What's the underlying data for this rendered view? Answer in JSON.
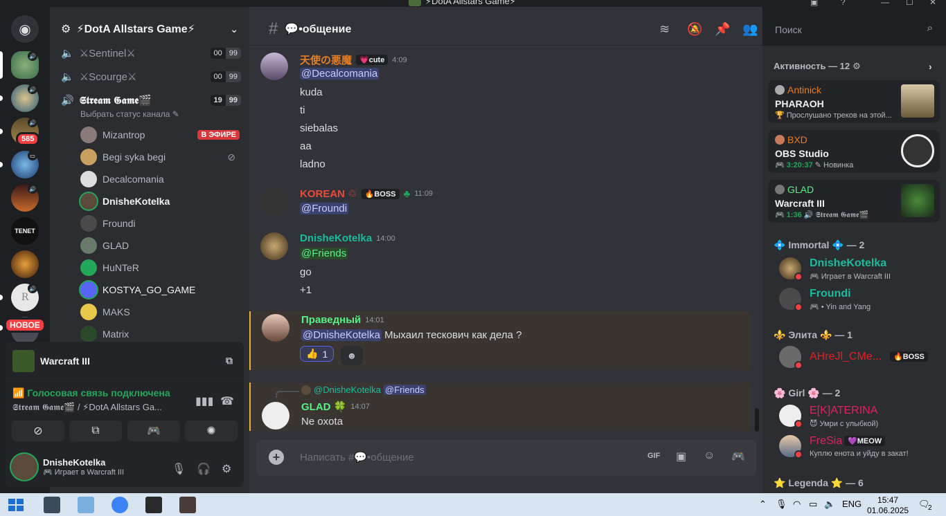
{
  "window": {
    "title": "⚡DotA Allstars Game⚡"
  },
  "servers": {
    "mention_badge": "585",
    "new_badge": "НОВОЕ",
    "tenet_label": "TENET",
    "r_label": "R"
  },
  "sidebar": {
    "server_name": "⚡DotA Allstars Game⚡",
    "channels": [
      {
        "name": "⚔Sentinel⚔",
        "left": "00",
        "right": "99"
      },
      {
        "name": "⚔Scourge⚔",
        "left": "00",
        "right": "99"
      },
      {
        "name": "𝕾𝖙𝖗𝖊𝖆𝖒 𝕲𝖆𝖒𝖊🎬",
        "left": "19",
        "right": "99",
        "status_hint": "Выбрать статус канала"
      }
    ],
    "voice_users": [
      {
        "name": "Mizantrop",
        "badge": "В ЭФИРЕ"
      },
      {
        "name": "Begi syka begi"
      },
      {
        "name": "Decalcomania"
      },
      {
        "name": "DnisheKotelka"
      },
      {
        "name": "Froundi"
      },
      {
        "name": "GLAD"
      },
      {
        "name": "HuNTeR"
      },
      {
        "name": "KOSTYA_GO_GAME"
      },
      {
        "name": "MAKS"
      },
      {
        "name": "Matrix"
      }
    ]
  },
  "voice_panel": {
    "app": "Warcraft III",
    "status": "Голосовая связь подключена",
    "location": "𝕾𝖙𝖗𝖊𝖆𝖒 𝕲𝖆𝖒𝖊🎬 / ⚡DotA Allstars Ga..."
  },
  "user": {
    "name": "DnisheKotelka",
    "status": "Играет в Warcraft III"
  },
  "chat": {
    "channel": "💬•общение",
    "placeholder": "Написать #💬•общение",
    "messages": [
      {
        "author": "天使の悪魔",
        "badge": "💗cute",
        "time": "4:09",
        "lines": [
          "@Decalcomania",
          "kuda",
          "ti",
          "siebalas",
          "aa",
          "ladno"
        ]
      },
      {
        "author": "KOREAN ♲",
        "badge": "🔥BOSS",
        "time": "11:09",
        "lines": [
          "@Froundi"
        ]
      },
      {
        "author": "DnisheKotelka",
        "time": "14:00",
        "lines": [
          "@Friends",
          "go",
          "+1"
        ]
      },
      {
        "author": "Праведный",
        "time": "14:01",
        "mention": "@DnisheKotelka",
        "text": "Мыхаил тескович как дела ?",
        "reaction_count": "1"
      },
      {
        "author": "GLAD 🍀",
        "time": "14:07",
        "reply_to": "@DnisheKotelka",
        "reply_mention": "@Friends",
        "lines": [
          "Ne oxota"
        ]
      }
    ]
  },
  "search": {
    "placeholder": "Поиск"
  },
  "activity": {
    "header": "Активность — 12",
    "cards": [
      {
        "user": "Antinick",
        "game": "PHARAOH",
        "detail": "🏆 Прослушано треков на этой..."
      },
      {
        "user": "BXD",
        "game": "OBS Studio",
        "timer": "3:20:37",
        "detail": "Новинка"
      },
      {
        "user": "GLAD",
        "game": "Warcraft III",
        "timer": "1:36",
        "detail": "𝕾𝖙𝖗𝖊𝖆𝖒 𝕲𝖆𝖒𝖊🎬"
      }
    ]
  },
  "members": {
    "groups": [
      {
        "title": "💠 Immortal 💠 — 2"
      },
      {
        "title": "⚜️ Элита ⚜️ — 1"
      },
      {
        "title": "🌸 Girl 🌸 — 2"
      },
      {
        "title": "⭐ Legenda ⭐ — 6"
      }
    ],
    "list": [
      {
        "name": "DnisheKotelka",
        "status": "Играет в Warcraft III",
        "color": "#1abc9c"
      },
      {
        "name": "Froundi",
        "status": "• Yin and Yang",
        "color": "#1abc9c"
      },
      {
        "name": "AHreJl_CMe...",
        "badge": "🔥BOSS",
        "color": "#e91e1e"
      },
      {
        "name": "E[K]ATERINA",
        "status": "😈 Умри с улыбкой)",
        "color": "#e91e63"
      },
      {
        "name": "FreSia",
        "badge": "💜MEOW",
        "status": "Куплю енота и уйду в закат!",
        "color": "#e91e63"
      }
    ]
  },
  "taskbar": {
    "lang": "ENG",
    "time": "15:47",
    "date": "01.06.2025",
    "notif_count": "2"
  },
  "colors": {
    "accent": "#5865f2",
    "online": "#23a55a",
    "dnd": "#f23f42",
    "highlight": "#f0b232"
  }
}
